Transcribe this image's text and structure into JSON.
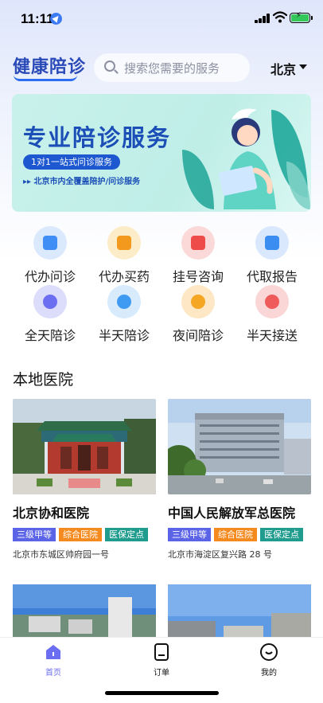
{
  "status_bar": {
    "time": "11:11"
  },
  "header": {
    "app_title": "健康陪诊",
    "search_placeholder": "搜索您需要的服务",
    "city": "北京"
  },
  "banner": {
    "title": "专业陪诊服务",
    "pill": "1对1一站式问诊服务",
    "subtitle": "北京市内全覆盖陪护/问诊服务"
  },
  "services": [
    {
      "label": "代办问诊",
      "icon": "chat-icon",
      "color": "#3f8ef5",
      "bg": "#dbe9fd"
    },
    {
      "label": "代办买药",
      "icon": "medicine-icon",
      "color": "#f39a1e",
      "bg": "#fdecc8"
    },
    {
      "label": "挂号咨询",
      "icon": "calendar-icon",
      "color": "#ee4b4b",
      "bg": "#fbd9d9"
    },
    {
      "label": "代取报告",
      "icon": "report-icon",
      "color": "#3c8df2",
      "bg": "#d9e8fc"
    },
    {
      "label": "全天陪诊",
      "icon": "sun-icon",
      "color": "#6b6ef0",
      "bg": "#dcdcfb"
    },
    {
      "label": "半天陪诊",
      "icon": "half-sun-icon",
      "color": "#3f9af2",
      "bg": "#d7ebfd"
    },
    {
      "label": "夜间陪诊",
      "icon": "moon-icon",
      "color": "#f5a623",
      "bg": "#fde7c4"
    },
    {
      "label": "半天接送",
      "icon": "person-icon",
      "color": "#ef5a5a",
      "bg": "#fbd6d6"
    }
  ],
  "section": {
    "title": "本地医院"
  },
  "hospitals": [
    {
      "name": "北京协和医院",
      "tags": [
        "三级甲等",
        "综合医院",
        "医保定点"
      ],
      "address": "北京市东城区帅府园一号"
    },
    {
      "name": "中国人民解放军总医院",
      "tags": [
        "三级甲等",
        "综合医院",
        "医保定点"
      ],
      "address": "北京市海淀区复兴路 28 号"
    }
  ],
  "tabbar": {
    "tabs": [
      {
        "label": "首页",
        "active": true
      },
      {
        "label": "订单",
        "active": false
      },
      {
        "label": "我的",
        "active": false
      }
    ]
  },
  "colors": {
    "primary": "#2e6cf0",
    "accent_text": "#1b4fb7"
  }
}
